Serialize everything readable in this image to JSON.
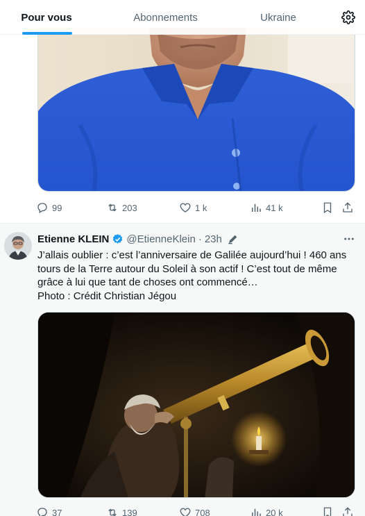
{
  "tabs": [
    {
      "label": "Pour vous",
      "active": true
    },
    {
      "label": "Abonnements",
      "active": false
    },
    {
      "label": "Ukraine",
      "active": false
    }
  ],
  "colors": {
    "accent": "#1d9bf0",
    "text": "#0f1419",
    "secondary": "#536471",
    "divider": "#eff3f4"
  },
  "icons": {
    "settings": "gear-icon",
    "reply": "reply-icon",
    "retweet": "retweet-icon",
    "like": "heart-icon",
    "views": "views-icon",
    "bookmark": "bookmark-icon",
    "share": "share-icon",
    "verified": "verified-badge-icon",
    "edited": "pencil-icon",
    "more": "more-icon"
  },
  "tweet1": {
    "replies": "99",
    "retweets": "203",
    "likes": "1 k",
    "views": "41 k"
  },
  "tweet2": {
    "author_name": "Etienne KLEIN",
    "handle": "@EtienneKlein",
    "separator": "·",
    "time": "23h",
    "text_lines": [
      "J’allais oublier : c’est l’anniversaire de Galilée aujourd’hui ! 460 ans",
      "tours de la Terre autour du Soleil à son actif ! C’est tout de même",
      "grâce à lui que tant de choses ont commencé…",
      "Photo : Crédit Christian Jégou"
    ],
    "replies": "37",
    "retweets": "139",
    "likes": "708",
    "views": "20 k"
  }
}
